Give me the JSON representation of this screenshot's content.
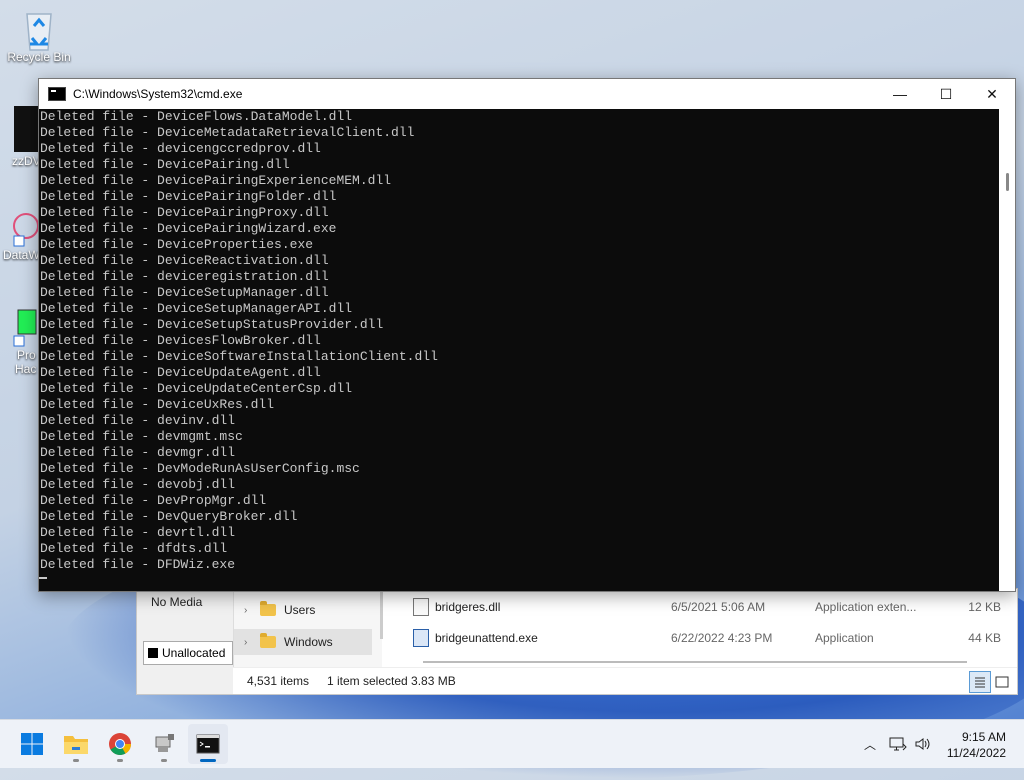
{
  "desktop": {
    "recycle_bin_label": "Recycle Bin",
    "partial_labels": [
      "zzDV",
      "DataW",
      "Pro",
      "Hac"
    ]
  },
  "explorer": {
    "disk_panel": {
      "no_media": "No Media",
      "unallocated": "Unallocated"
    },
    "nav": [
      {
        "label": "Users",
        "selected": false
      },
      {
        "label": "Windows",
        "selected": true
      }
    ],
    "files": [
      {
        "name": "bridgeres.dll",
        "date": "6/5/2021 5:06 AM",
        "type": "Application exten...",
        "size": "12 KB"
      },
      {
        "name": "bridgeunattend.exe",
        "date": "6/22/2022 4:23 PM",
        "type": "Application",
        "size": "44 KB"
      }
    ],
    "status": {
      "item_count": "4,531 items",
      "selection": "1 item selected  3.83 MB"
    }
  },
  "cmd": {
    "title": "C:\\Windows\\System32\\cmd.exe",
    "controls": {
      "minimize": "—",
      "maximize": "☐",
      "close": "✕"
    },
    "lines": [
      "Deleted file - DeviceFlows.DataModel.dll",
      "Deleted file - DeviceMetadataRetrievalClient.dll",
      "Deleted file - devicengccredprov.dll",
      "Deleted file - DevicePairing.dll",
      "Deleted file - DevicePairingExperienceMEM.dll",
      "Deleted file - DevicePairingFolder.dll",
      "Deleted file - DevicePairingProxy.dll",
      "Deleted file - DevicePairingWizard.exe",
      "Deleted file - DeviceProperties.exe",
      "Deleted file - DeviceReactivation.dll",
      "Deleted file - deviceregistration.dll",
      "Deleted file - DeviceSetupManager.dll",
      "Deleted file - DeviceSetupManagerAPI.dll",
      "Deleted file - DeviceSetupStatusProvider.dll",
      "Deleted file - DevicesFlowBroker.dll",
      "Deleted file - DeviceSoftwareInstallationClient.dll",
      "Deleted file - DeviceUpdateAgent.dll",
      "Deleted file - DeviceUpdateCenterCsp.dll",
      "Deleted file - DeviceUxRes.dll",
      "Deleted file - devinv.dll",
      "Deleted file - devmgmt.msc",
      "Deleted file - devmgr.dll",
      "Deleted file - DevModeRunAsUserConfig.msc",
      "Deleted file - devobj.dll",
      "Deleted file - DevPropMgr.dll",
      "Deleted file - DevQueryBroker.dll",
      "Deleted file - devrtl.dll",
      "Deleted file - dfdts.dll",
      "Deleted file - DFDWiz.exe"
    ]
  },
  "taskbar": {
    "apps": [
      {
        "icon": "windows-start-icon",
        "active": false,
        "running": false
      },
      {
        "icon": "file-explorer-icon",
        "active": false,
        "running": true
      },
      {
        "icon": "chrome-icon",
        "active": false,
        "running": true
      },
      {
        "icon": "usb-drive-icon",
        "active": false,
        "running": true
      },
      {
        "icon": "cmd-icon",
        "active": true,
        "running": true
      }
    ],
    "clock": {
      "time": "9:15 AM",
      "date": "11/24/2022"
    }
  }
}
